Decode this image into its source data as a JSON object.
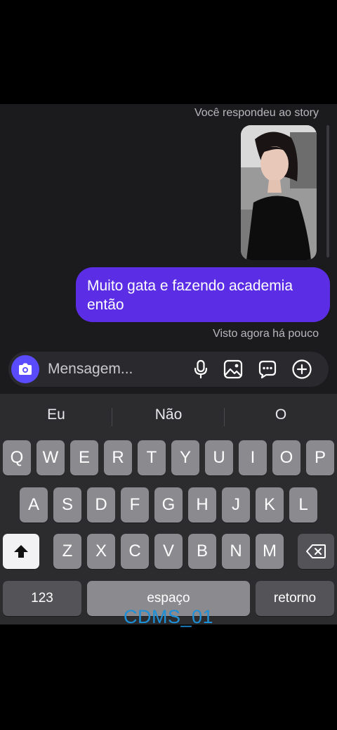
{
  "chat": {
    "replied_label": "Você respondeu ao story",
    "message_text": "Muito gata e fazendo academia então",
    "seen_label": "Visto agora há pouco"
  },
  "composer": {
    "placeholder": "Mensagem...",
    "icons": [
      "camera-icon",
      "microphone-icon",
      "image-icon",
      "sticker-icon",
      "plus-icon"
    ]
  },
  "keyboard": {
    "suggestions": [
      "Eu",
      "Não",
      "O"
    ],
    "row1": [
      "Q",
      "W",
      "E",
      "R",
      "T",
      "Y",
      "U",
      "I",
      "O",
      "P"
    ],
    "row2": [
      "A",
      "S",
      "D",
      "F",
      "G",
      "H",
      "J",
      "K",
      "L"
    ],
    "row3": [
      "Z",
      "X",
      "C",
      "V",
      "B",
      "N",
      "M"
    ],
    "numbers_label": "123",
    "space_label": "espaço",
    "return_label": "retorno"
  },
  "watermark": "CDMS_01",
  "colors": {
    "bubble": "#5b2ee6",
    "camera_button": "#5b4bff",
    "watermark": "#1e90d8"
  }
}
